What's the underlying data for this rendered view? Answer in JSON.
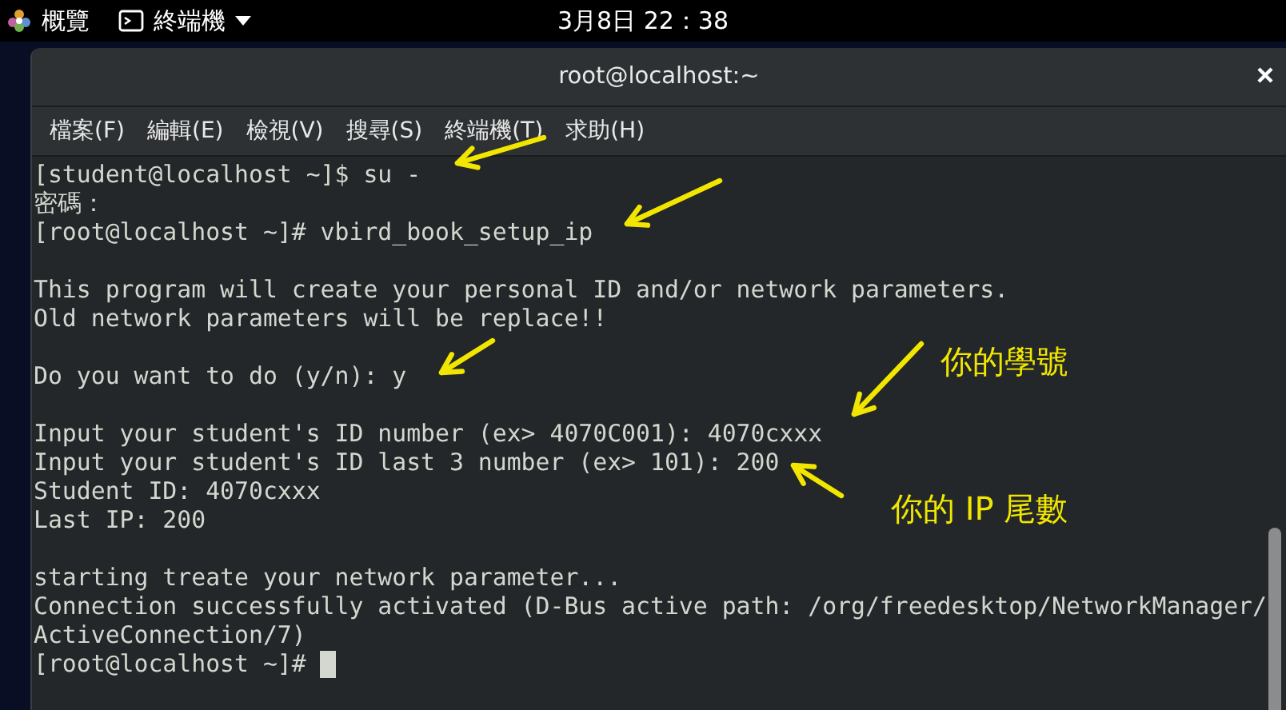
{
  "top_bar": {
    "activities": "概覽",
    "app_menu": "終端機",
    "clock": "3月8日 22：38"
  },
  "window": {
    "title": "root@localhost:~",
    "menu": [
      "檔案(F)",
      "編輯(E)",
      "檢視(V)",
      "搜尋(S)",
      "終端機(T)",
      "求助(H)"
    ],
    "output_blocks": [
      [
        "[student@localhost ~]$ su -",
        "密碼：",
        "[root@localhost ~]# vbird_book_setup_ip"
      ],
      [
        "This program will create your personal ID and/or network parameters.",
        "Old network parameters will be replace!!"
      ],
      [
        "Do you want to do (y/n): y"
      ],
      [
        "Input your student's ID number (ex> 4070C001): 4070cxxx",
        "Input your student's ID last 3 number (ex> 101): 200",
        "Student ID: 4070cxxx",
        "Last IP: 200"
      ],
      [
        "starting treate your network parameter...",
        "Connection successfully activated (D-Bus active path: /org/freedesktop/NetworkManager/",
        "ActiveConnection/7)",
        "[root@localhost ~]# "
      ]
    ]
  },
  "annotations": [
    "你的學號",
    "你的 IP 尾數"
  ]
}
